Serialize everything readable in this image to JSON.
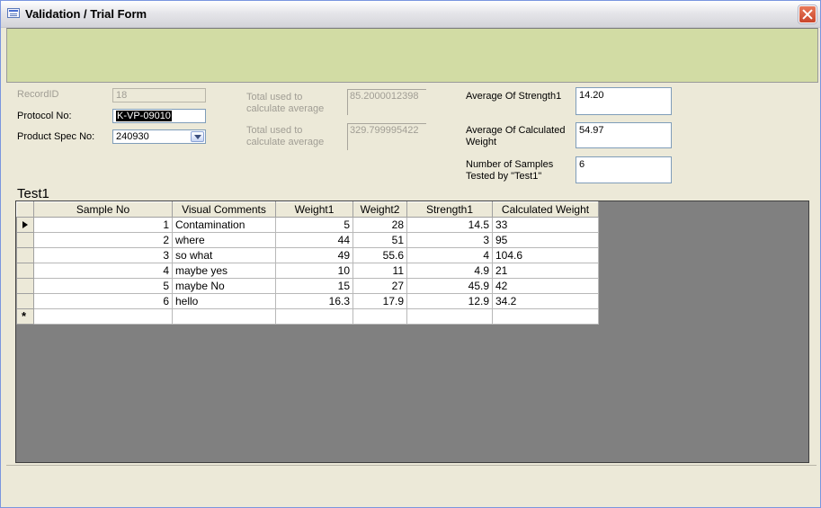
{
  "window": {
    "title": "Validation / Trial Form",
    "close_icon": "close-icon"
  },
  "form": {
    "record_id": {
      "label": "RecordID",
      "value": "18"
    },
    "protocol_no": {
      "label": "Protocol No:",
      "value": "K-VP-09010"
    },
    "product_spec_no": {
      "label": "Product Spec No:",
      "value": "240930"
    },
    "total_strength": {
      "label_line1": "Total used to",
      "label_line2": "calculate average",
      "value": "85.2000012398"
    },
    "total_weight": {
      "label_line1": "Total used to",
      "label_line2": "calculate average",
      "value": "329.799995422"
    },
    "avg_strength": {
      "label": "Average Of Strength1",
      "value": "14.20"
    },
    "avg_weight": {
      "label_line1": "Average Of Calculated",
      "label_line2": "Weight",
      "value": "54.97"
    },
    "num_samples": {
      "label_line1": "Number of Samples",
      "label_line2": "Tested by \"Test1\"",
      "value": "6"
    }
  },
  "subform": {
    "title": "Test1",
    "columns": [
      "Sample No",
      "Visual Comments",
      "Weight1",
      "Weight2",
      "Strength1",
      "Calculated Weight"
    ],
    "rows": [
      [
        "1",
        "Contamination",
        "5",
        "28",
        "14.5",
        "33"
      ],
      [
        "2",
        "where",
        "44",
        "51",
        "3",
        "95"
      ],
      [
        "3",
        "so what",
        "49",
        "55.6",
        "4",
        "104.6"
      ],
      [
        "4",
        "maybe yes",
        "10",
        "11",
        "4.9",
        "21"
      ],
      [
        "5",
        "maybe No",
        "15",
        "27",
        "45.9",
        "42"
      ],
      [
        "6",
        "hello",
        "16.3",
        "17.9",
        "12.9",
        "34.2"
      ]
    ],
    "new_row_marker": "*"
  },
  "colors": {
    "header_band": "#d2dca4",
    "grid_background": "#808080"
  }
}
